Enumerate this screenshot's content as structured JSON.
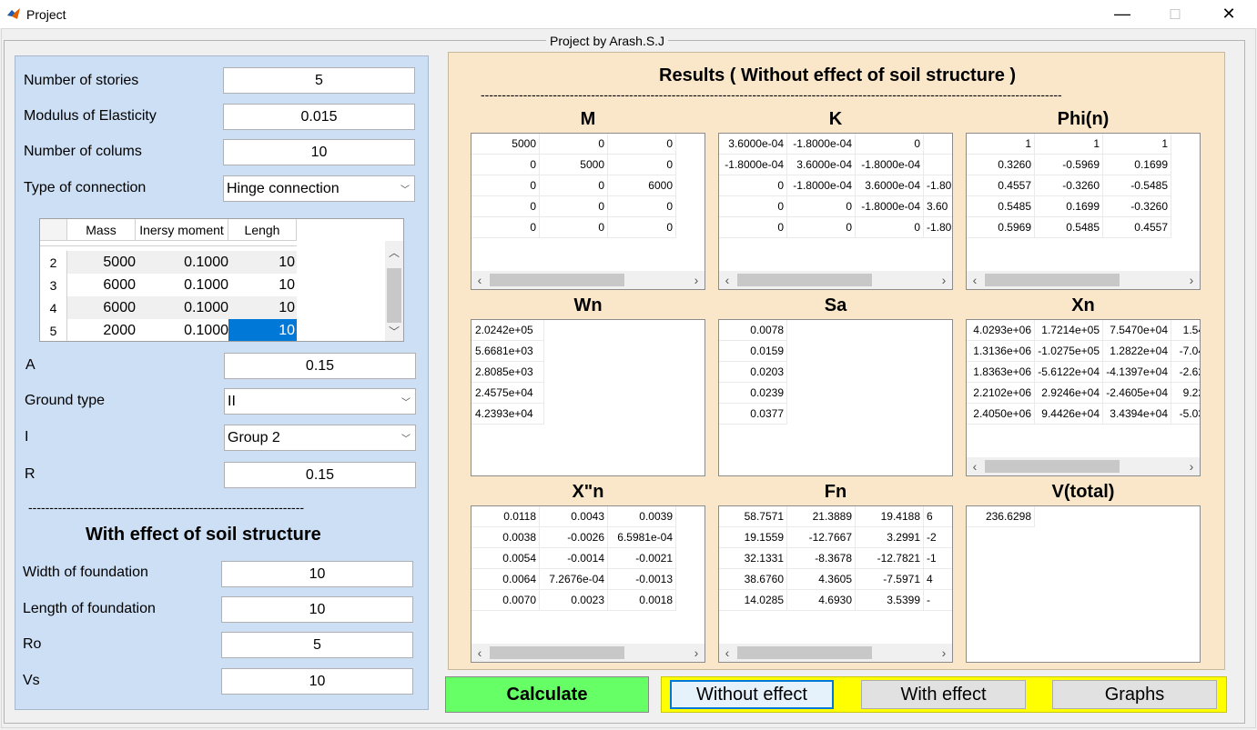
{
  "window": {
    "title": "Project",
    "minimize": "—",
    "maximize": "☐",
    "close": "✕"
  },
  "group_title": "Project by Arash.S.J",
  "inputs": {
    "stories_label": "Number of stories",
    "stories_value": "5",
    "elasticity_label": "Modulus of Elasticity",
    "elasticity_value": "0.015",
    "columns_label": "Number of colums",
    "columns_value": "10",
    "connection_label": "Type of connection",
    "connection_value": "Hinge connection",
    "table_headers": [
      "Mass",
      "Inersy moment",
      "Lengh"
    ],
    "table_rows": [
      {
        "idx": "2",
        "mass": "5000",
        "moment": "0.1000",
        "length": "10"
      },
      {
        "idx": "3",
        "mass": "6000",
        "moment": "0.1000",
        "length": "10"
      },
      {
        "idx": "4",
        "mass": "6000",
        "moment": "0.1000",
        "length": "10"
      },
      {
        "idx": "5",
        "mass": "2000",
        "moment": "0.1000",
        "length": "10"
      }
    ],
    "a_label": "A",
    "a_value": "0.15",
    "ground_label": "Ground type",
    "ground_value": "II",
    "i_label": "I",
    "i_value": "Group 2",
    "r_label": "R",
    "r_value": "0.15",
    "divider": "-----------------------------------------------------------------",
    "soil_heading": "With effect of soil structure",
    "width_label": "Width of foundation",
    "width_value": "10",
    "length_label": "Length of foundation",
    "length_value": "10",
    "ro_label": "Ro",
    "ro_value": "5",
    "vs_label": "Vs",
    "vs_value": "10"
  },
  "results": {
    "heading": "Results ( Without effect of soil structure )",
    "divider": "-----------------------------------------------------------------------------------------------------------------------------------------",
    "M": {
      "title": "M",
      "rows": [
        [
          "5000",
          "0",
          "0"
        ],
        [
          "0",
          "5000",
          "0"
        ],
        [
          "0",
          "0",
          "6000"
        ],
        [
          "0",
          "0",
          "0"
        ],
        [
          "0",
          "0",
          "0"
        ]
      ]
    },
    "K": {
      "title": "K",
      "rows": [
        [
          "3.6000e-04",
          "-1.8000e-04",
          "0"
        ],
        [
          "-1.8000e-04",
          "3.6000e-04",
          "-1.8000e-04"
        ],
        [
          "0",
          "-1.8000e-04",
          "3.6000e-04"
        ],
        [
          "0",
          "0",
          "-1.8000e-04"
        ],
        [
          "0",
          "0",
          "0"
        ]
      ],
      "extra": [
        "",
        "",
        "-1.80",
        "3.60",
        "-1.80"
      ]
    },
    "Phi": {
      "title": "Phi(n)",
      "rows": [
        [
          "1",
          "1",
          "1"
        ],
        [
          "0.3260",
          "-0.5969",
          "0.1699"
        ],
        [
          "0.4557",
          "-0.3260",
          "-0.5485"
        ],
        [
          "0.5485",
          "0.1699",
          "-0.3260"
        ],
        [
          "0.5969",
          "0.5485",
          "0.4557"
        ]
      ]
    },
    "Wn": {
      "title": "Wn",
      "rows": [
        [
          "2.0242e+05"
        ],
        [
          "5.6681e+03"
        ],
        [
          "2.8085e+03"
        ],
        [
          "2.4575e+04"
        ],
        [
          "4.2393e+04"
        ]
      ]
    },
    "Sa": {
      "title": "Sa",
      "rows": [
        [
          "0.0078"
        ],
        [
          "0.0159"
        ],
        [
          "0.0203"
        ],
        [
          "0.0239"
        ],
        [
          "0.0377"
        ]
      ]
    },
    "Xn": {
      "title": "Xn",
      "rows": [
        [
          "4.0293e+06",
          "1.7214e+05",
          "7.5470e+04",
          "1.54"
        ],
        [
          "1.3136e+06",
          "-1.0275e+05",
          "1.2822e+04",
          "-7.04"
        ],
        [
          "1.8363e+06",
          "-5.6122e+04",
          "-4.1397e+04",
          "-2.62"
        ],
        [
          "2.2102e+06",
          "2.9246e+04",
          "-2.4605e+04",
          "9.22"
        ],
        [
          "2.4050e+06",
          "9.4426e+04",
          "3.4394e+04",
          "-5.03"
        ]
      ]
    },
    "Xpp": {
      "title": "X\"n",
      "rows": [
        [
          "0.0118",
          "0.0043",
          "0.0039"
        ],
        [
          "0.0038",
          "-0.0026",
          "6.5981e-04"
        ],
        [
          "0.0054",
          "-0.0014",
          "-0.0021"
        ],
        [
          "0.0064",
          "7.2676e-04",
          "-0.0013"
        ],
        [
          "0.0070",
          "0.0023",
          "0.0018"
        ]
      ]
    },
    "Fn": {
      "title": "Fn",
      "rows": [
        [
          "58.7571",
          "21.3889",
          "19.4188"
        ],
        [
          "19.1559",
          "-12.7667",
          "3.2991"
        ],
        [
          "32.1331",
          "-8.3678",
          "-12.7821"
        ],
        [
          "38.6760",
          "4.3605",
          "-7.5971"
        ],
        [
          "14.0285",
          "4.6930",
          "3.5399"
        ]
      ],
      "extra": [
        "6",
        "-2",
        "-1",
        "4",
        "-"
      ]
    },
    "V": {
      "title": "V(total)",
      "rows": [
        [
          "236.6298"
        ]
      ]
    }
  },
  "buttons": {
    "calculate": "Calculate",
    "without": "Without effect",
    "with": "With effect",
    "graphs": "Graphs"
  },
  "colors": {
    "left_panel": "#cddff5",
    "right_panel": "#fae6c8",
    "calculate": "#66ff66",
    "button_bar": "#ffff00",
    "selected_cell": "#0078d7"
  }
}
